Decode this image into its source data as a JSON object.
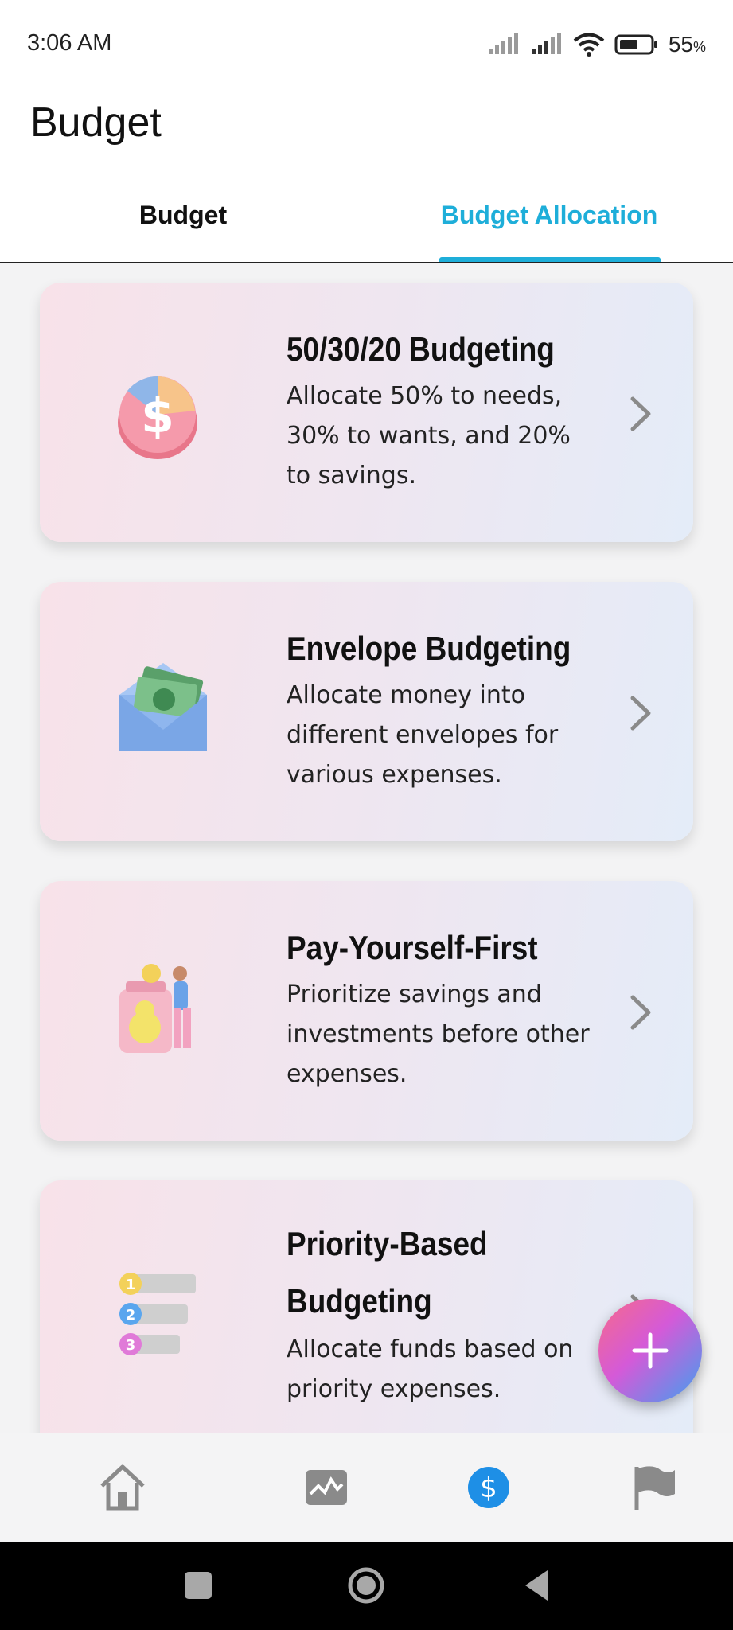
{
  "status": {
    "time": "3:06 AM",
    "battery_value": "55",
    "battery_unit": "%",
    "icons": [
      "signal-icon",
      "signal-icon",
      "wifi-icon",
      "battery-icon"
    ]
  },
  "header": {
    "title": "Budget",
    "tabs": [
      {
        "label": "Budget",
        "active": false
      },
      {
        "label": "Budget Allocation",
        "active": true
      }
    ],
    "accent_color": "#1eaed9"
  },
  "cards": [
    {
      "icon": "pie-dollar-icon",
      "title_lines": [
        "50/30/20 Budgeting"
      ],
      "desc_lines": [
        "Allocate 50% to needs,",
        "30% to wants, and 20%",
        "to savings."
      ]
    },
    {
      "icon": "envelope-money-icon",
      "title_lines": [
        "Envelope Budgeting"
      ],
      "desc_lines": [
        "Allocate money into",
        "different envelopes for",
        "various expenses."
      ]
    },
    {
      "icon": "savings-jar-icon",
      "title_lines": [
        "Pay-Yourself-First"
      ],
      "desc_lines": [
        "Prioritize savings and",
        "investments before other",
        "expenses."
      ]
    },
    {
      "icon": "priority-list-icon",
      "title_lines": [
        "Priority-Based",
        "Budgeting"
      ],
      "desc_lines": [
        "Allocate funds based on",
        "priority expenses."
      ]
    }
  ],
  "fab": {
    "icon": "plus-icon"
  },
  "bottom_nav": [
    {
      "icon": "home-icon",
      "active": false
    },
    {
      "icon": "chart-icon",
      "active": false
    },
    {
      "icon": "dollar-icon",
      "active": true
    },
    {
      "icon": "flag-icon",
      "active": false
    }
  ],
  "system_nav": [
    "recents-button",
    "home-button",
    "back-button"
  ]
}
